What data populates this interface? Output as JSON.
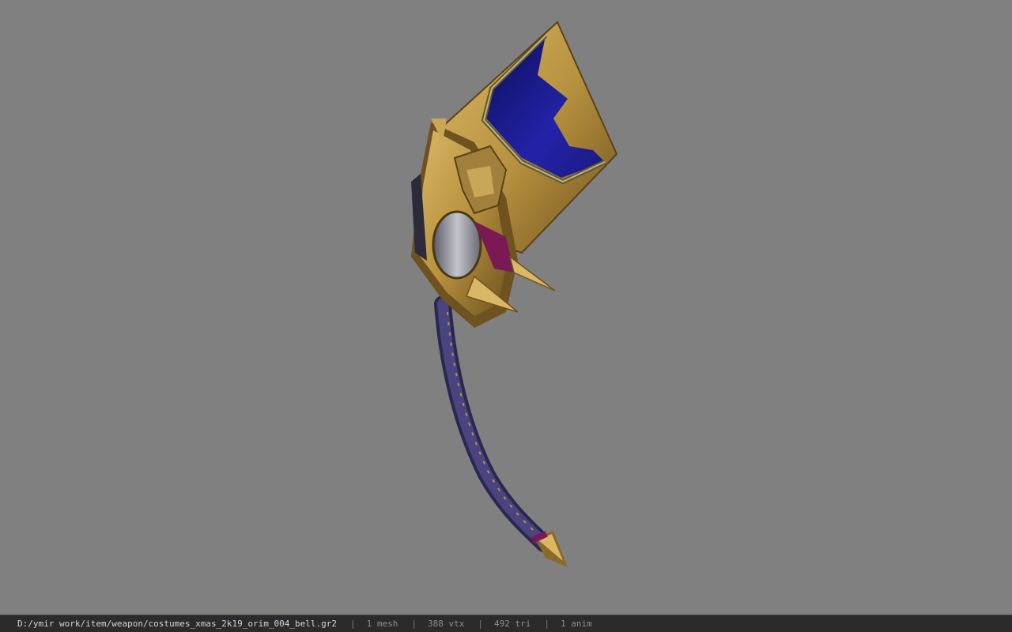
{
  "viewport": {
    "background_color": "#808080",
    "model": {
      "colors": {
        "gold": "#b8923e",
        "gold_dark": "#6e5220",
        "gold_light": "#d9b865",
        "blue": "#1f1f9a",
        "blue_dark": "#0d0d5a",
        "shaft": "#3a3668",
        "silver": "#9a9aa6",
        "magenta": "#7a1a55"
      }
    }
  },
  "status_bar": {
    "file_path": "D:/ymir work/item/weapon/costumes_xmas_2k19_orim_004_bell.gr2",
    "separator": "|",
    "mesh": "1 mesh",
    "vertices": "388 vtx",
    "triangles": "492 tri",
    "animations": "1 anim"
  }
}
